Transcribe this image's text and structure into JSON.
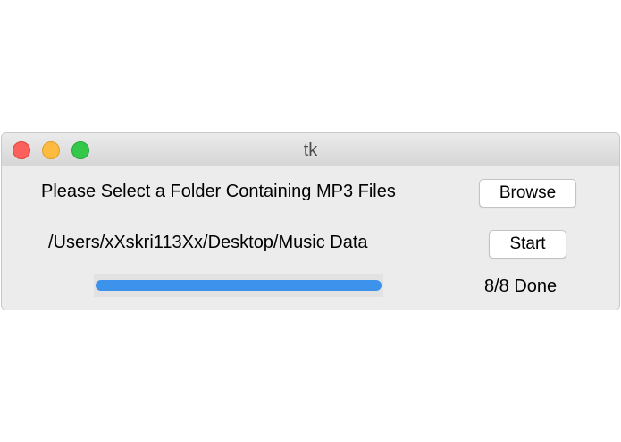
{
  "window": {
    "title": "tk"
  },
  "main": {
    "prompt_label": "Please Select a Folder Containing MP3 Files",
    "browse_button": "Browse",
    "selected_path": "/Users/xXskri113Xx/Desktop/Music Data",
    "start_button": "Start",
    "progress": {
      "fraction": 1.0,
      "status_text": "8/8 Done"
    }
  },
  "colors": {
    "progress_fill": "#3d92ec",
    "close": "#fc605c",
    "minimize": "#fdbc40",
    "maximize": "#34c84a"
  }
}
